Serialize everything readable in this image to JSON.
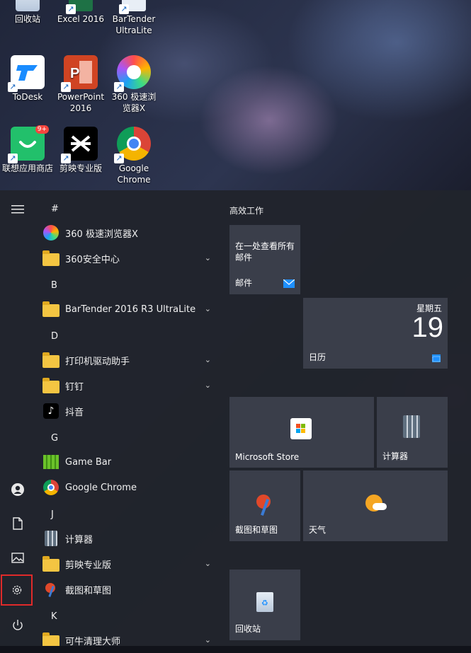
{
  "desktop": {
    "icons": [
      {
        "label": "回收站"
      },
      {
        "label": "Excel 2016"
      },
      {
        "label": "BarTender UltraLite"
      },
      {
        "label": "ToDesk"
      },
      {
        "label": "PowerPoint 2016"
      },
      {
        "label": "360 极速浏览器X"
      },
      {
        "label": "联想应用商店"
      },
      {
        "label": "剪映专业版"
      },
      {
        "label": "Google Chrome"
      }
    ],
    "badge": "9+"
  },
  "start_menu": {
    "sections": [
      {
        "letter": "#"
      },
      {
        "letter": "B"
      },
      {
        "letter": "D"
      },
      {
        "letter": "G"
      },
      {
        "letter": "J"
      },
      {
        "letter": "K"
      }
    ],
    "apps": [
      {
        "label": "360 极速浏览器X"
      },
      {
        "label": "360安全中心"
      },
      {
        "label": "BarTender 2016 R3 UltraLite"
      },
      {
        "label": "打印机驱动助手"
      },
      {
        "label": "钉钉"
      },
      {
        "label": "抖音"
      },
      {
        "label": "Game Bar"
      },
      {
        "label": "Google Chrome"
      },
      {
        "label": "计算器"
      },
      {
        "label": "剪映专业版"
      },
      {
        "label": "截图和草图"
      },
      {
        "label": "可牛清理大师"
      }
    ],
    "tiles_group_title": "高效工作",
    "tiles": {
      "mail_header": "在一处查看所有邮件",
      "mail": "邮件",
      "calendar": "日历",
      "calendar_day": "星期五",
      "calendar_date": "19",
      "store": "Microsoft Store",
      "calculator": "计算器",
      "snip": "截图和草图",
      "weather": "天气",
      "recycle": "回收站"
    }
  },
  "colors": {
    "menu_bg": "#21242c",
    "tile_bg": "#3a3e4a",
    "selection_outline": "#e02a2a",
    "accent_blue": "#0a78d7"
  }
}
